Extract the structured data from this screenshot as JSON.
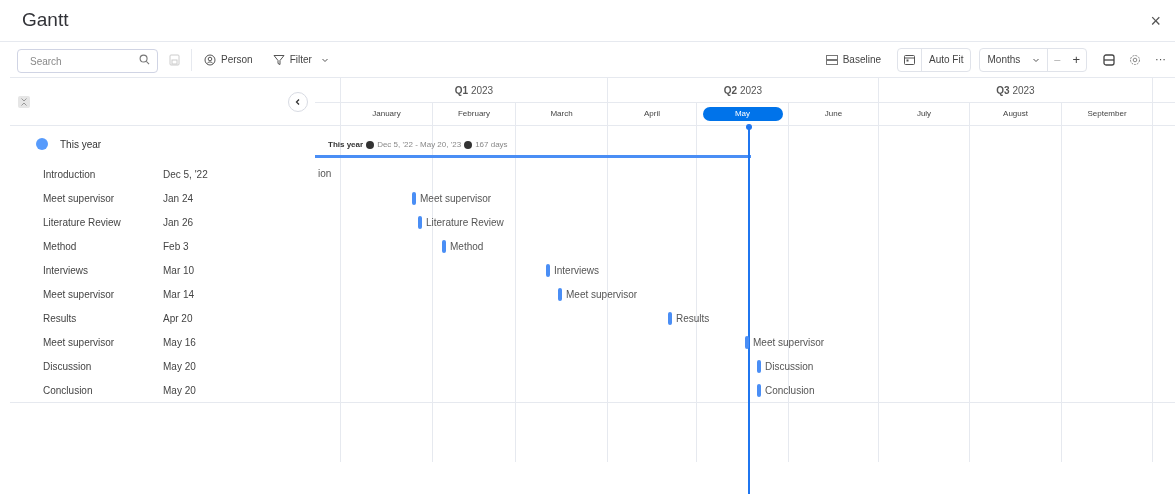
{
  "window": {
    "title": "Gantt",
    "close": "×"
  },
  "toolbar": {
    "search": {
      "placeholder": "Search"
    },
    "person": "Person",
    "filter": "Filter",
    "baseline": "Baseline",
    "auto_fit": "Auto Fit",
    "scale": "Months",
    "minus": "–",
    "plus": "+",
    "more": "···"
  },
  "quarters": [
    "**Q1** 2023",
    "**Q2** 2023",
    "**Q3** 2023"
  ],
  "months": [
    {
      "label": "January",
      "selected": false
    },
    {
      "label": "February",
      "selected": false
    },
    {
      "label": "March",
      "selected": false
    },
    {
      "label": "April",
      "selected": false
    },
    {
      "label": "May",
      "selected": true
    },
    {
      "label": "June",
      "selected": false
    },
    {
      "label": "July",
      "selected": false
    },
    {
      "label": "August",
      "selected": false
    },
    {
      "label": "September",
      "selected": false
    }
  ],
  "group": {
    "name": "This year",
    "color": "#579bfc",
    "summary": {
      "label": "This year",
      "range": "Dec 5, '22 - May 20, '23",
      "duration": "167 days"
    }
  },
  "rows": [
    {
      "name": "Introduction",
      "date": "Dec 5, '22",
      "bar_label": "ion"
    },
    {
      "name": "Meet supervisor",
      "date": "Jan 24",
      "bar_label": "Meet supervisor"
    },
    {
      "name": "Literature Review",
      "date": "Jan 26",
      "bar_label": "Literature Review"
    },
    {
      "name": "Method",
      "date": "Feb 3",
      "bar_label": "Method"
    },
    {
      "name": "Interviews",
      "date": "Mar 10",
      "bar_label": "Interviews"
    },
    {
      "name": "Meet supervisor",
      "date": "Mar 14",
      "bar_label": "Meet supervisor"
    },
    {
      "name": "Results",
      "date": "Apr 20",
      "bar_label": "Results"
    },
    {
      "name": "Meet supervisor",
      "date": "May 16",
      "bar_label": "Meet supervisor"
    },
    {
      "name": "Discussion",
      "date": "May 20",
      "bar_label": "Discussion"
    },
    {
      "name": "Conclusion",
      "date": "May 20",
      "bar_label": "Conclusion"
    }
  ]
}
